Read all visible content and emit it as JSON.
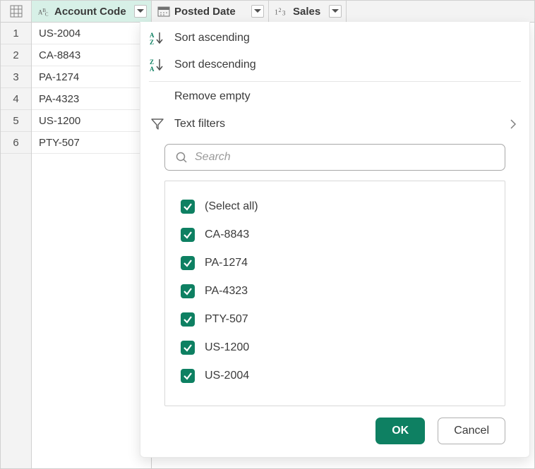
{
  "columns": [
    {
      "name": "Account Code",
      "type": "text"
    },
    {
      "name": "Posted Date",
      "type": "date"
    },
    {
      "name": "Sales",
      "type": "number"
    }
  ],
  "row_numbers": [
    "1",
    "2",
    "3",
    "4",
    "5",
    "6"
  ],
  "cells_col1": [
    "US-2004",
    "CA-8843",
    "PA-1274",
    "PA-4323",
    "US-1200",
    "PTY-507"
  ],
  "menu": {
    "sort_asc": "Sort ascending",
    "sort_desc": "Sort descending",
    "remove_empty": "Remove empty",
    "text_filters": "Text filters"
  },
  "search": {
    "placeholder": "Search",
    "value": ""
  },
  "filter_values": [
    "(Select all)",
    "CA-8843",
    "PA-1274",
    "PA-4323",
    "PTY-507",
    "US-1200",
    "US-2004"
  ],
  "buttons": {
    "ok": "OK",
    "cancel": "Cancel"
  },
  "colors": {
    "accent": "#0e8062",
    "header_active": "#d7f0e7"
  }
}
